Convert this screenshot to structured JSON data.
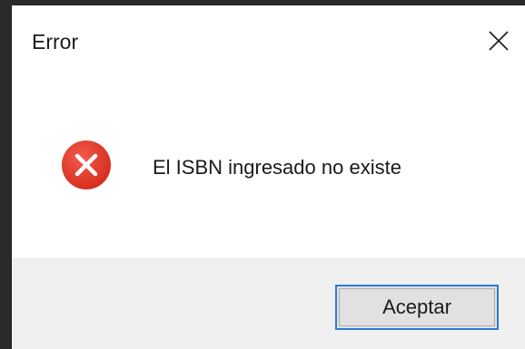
{
  "dialog": {
    "title": "Error",
    "message": "El ISBN ingresado no existe",
    "icon": "error-icon",
    "ok_label": "Aceptar",
    "close_icon": "close-icon"
  },
  "colors": {
    "error_red": "#e81123",
    "accent_blue": "#2b7cd3",
    "footer_bg": "#f0f0f0"
  }
}
